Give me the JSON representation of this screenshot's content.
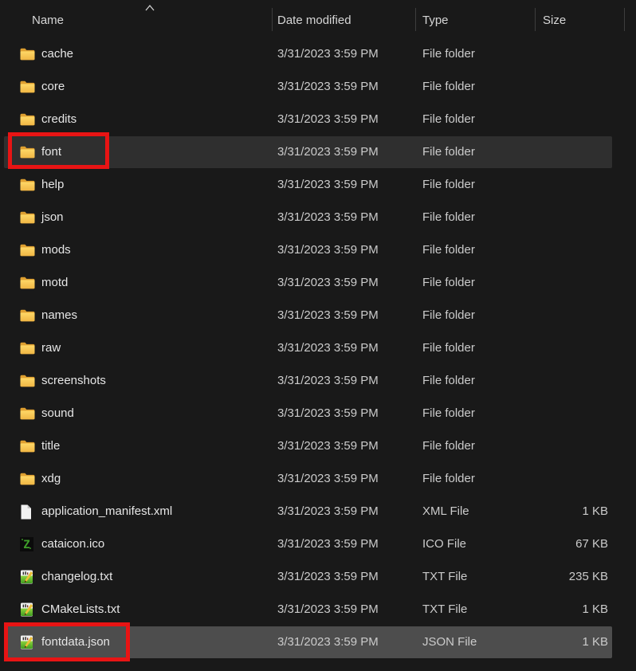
{
  "colors": {
    "background": "#191919",
    "row_hover": "#2f2f2f",
    "row_selected": "#4d4d4d",
    "annotation_red": "#e81414",
    "folder_yellow": "#f6c64c",
    "header_text": "#d6d6d6",
    "primary_text": "#e6e6e6",
    "secondary_text": "#cbcbcb"
  },
  "header": {
    "sort": {
      "column": "Name",
      "direction": "ascending",
      "icon": "chevron-up-icon"
    },
    "columns": [
      {
        "label": "Name"
      },
      {
        "label": "Date modified"
      },
      {
        "label": "Type"
      },
      {
        "label": "Size"
      }
    ]
  },
  "rows": [
    {
      "name": "cache",
      "date_modified": "3/31/2023 3:59 PM",
      "type": "File folder",
      "size": "",
      "icon": "folder",
      "state": ""
    },
    {
      "name": "core",
      "date_modified": "3/31/2023 3:59 PM",
      "type": "File folder",
      "size": "",
      "icon": "folder",
      "state": ""
    },
    {
      "name": "credits",
      "date_modified": "3/31/2023 3:59 PM",
      "type": "File folder",
      "size": "",
      "icon": "folder",
      "state": ""
    },
    {
      "name": "font",
      "date_modified": "3/31/2023 3:59 PM",
      "type": "File folder",
      "size": "",
      "icon": "folder",
      "state": "hover",
      "annotated": true
    },
    {
      "name": "help",
      "date_modified": "3/31/2023 3:59 PM",
      "type": "File folder",
      "size": "",
      "icon": "folder",
      "state": ""
    },
    {
      "name": "json",
      "date_modified": "3/31/2023 3:59 PM",
      "type": "File folder",
      "size": "",
      "icon": "folder",
      "state": ""
    },
    {
      "name": "mods",
      "date_modified": "3/31/2023 3:59 PM",
      "type": "File folder",
      "size": "",
      "icon": "folder",
      "state": ""
    },
    {
      "name": "motd",
      "date_modified": "3/31/2023 3:59 PM",
      "type": "File folder",
      "size": "",
      "icon": "folder",
      "state": ""
    },
    {
      "name": "names",
      "date_modified": "3/31/2023 3:59 PM",
      "type": "File folder",
      "size": "",
      "icon": "folder",
      "state": ""
    },
    {
      "name": "raw",
      "date_modified": "3/31/2023 3:59 PM",
      "type": "File folder",
      "size": "",
      "icon": "folder",
      "state": ""
    },
    {
      "name": "screenshots",
      "date_modified": "3/31/2023 3:59 PM",
      "type": "File folder",
      "size": "",
      "icon": "folder",
      "state": ""
    },
    {
      "name": "sound",
      "date_modified": "3/31/2023 3:59 PM",
      "type": "File folder",
      "size": "",
      "icon": "folder",
      "state": ""
    },
    {
      "name": "title",
      "date_modified": "3/31/2023 3:59 PM",
      "type": "File folder",
      "size": "",
      "icon": "folder",
      "state": ""
    },
    {
      "name": "xdg",
      "date_modified": "3/31/2023 3:59 PM",
      "type": "File folder",
      "size": "",
      "icon": "folder",
      "state": ""
    },
    {
      "name": "application_manifest.xml",
      "date_modified": "3/31/2023 3:59 PM",
      "type": "XML File",
      "size": "1 KB",
      "icon": "document",
      "state": ""
    },
    {
      "name": "cataicon.ico",
      "date_modified": "3/31/2023 3:59 PM",
      "type": "ICO File",
      "size": "67 KB",
      "icon": "cataclysm-z",
      "state": ""
    },
    {
      "name": "changelog.txt",
      "date_modified": "3/31/2023 3:59 PM",
      "type": "TXT File",
      "size": "235 KB",
      "icon": "text-editor",
      "state": ""
    },
    {
      "name": "CMakeLists.txt",
      "date_modified": "3/31/2023 3:59 PM",
      "type": "TXT File",
      "size": "1 KB",
      "icon": "text-editor",
      "state": ""
    },
    {
      "name": "fontdata.json",
      "date_modified": "3/31/2023 3:59 PM",
      "type": "JSON File",
      "size": "1 KB",
      "icon": "text-editor",
      "state": "selected",
      "annotated": true
    }
  ],
  "annotations": [
    {
      "target": "font",
      "shape": "red-rectangle"
    },
    {
      "target": "fontdata.json",
      "shape": "red-rectangle"
    }
  ]
}
